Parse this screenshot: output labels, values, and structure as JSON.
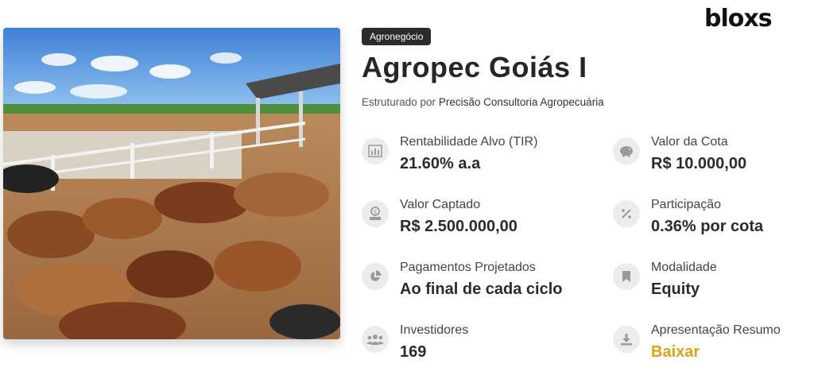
{
  "brand": {
    "logo_text": "bloxs"
  },
  "project": {
    "category_tag": "Agronegócio",
    "title": "Agropec Goiás I",
    "structured_by_prefix": "Estruturado por",
    "structured_by_org": "Precisão Consultoria Agropecuária",
    "image_alt": "Gado em curral"
  },
  "stats": [
    {
      "icon": "bar-chart-icon",
      "label": "Rentabilidade Alvo (TIR)",
      "value": "21.60% a.a"
    },
    {
      "icon": "piggy-bank-icon",
      "label": "Valor da Cota",
      "value": "R$ 10.000,00"
    },
    {
      "icon": "money-stack-icon",
      "label": "Valor Captado",
      "value": "R$ 2.500.000,00"
    },
    {
      "icon": "percent-icon",
      "label": "Participação",
      "value": "0.36% por cota"
    },
    {
      "icon": "pie-chart-icon",
      "label": "Pagamentos Projetados",
      "value": "Ao final de cada ciclo"
    },
    {
      "icon": "bookmark-icon",
      "label": "Modalidade",
      "value": "Equity"
    },
    {
      "icon": "users-icon",
      "label": "Investidores",
      "value": "169"
    },
    {
      "icon": "download-icon",
      "label": "Apresentação Resumo",
      "value": "Baixar"
    }
  ],
  "colors": {
    "accent_link": "#d8a417",
    "icon_bg": "#ececec",
    "tag_bg": "#2b2b2b"
  }
}
